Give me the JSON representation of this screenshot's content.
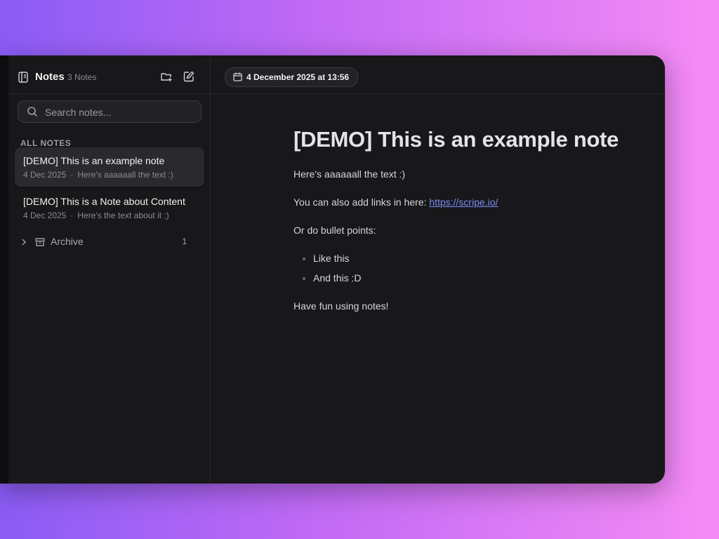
{
  "sidebar": {
    "title": "Notes",
    "count": "3 Notes",
    "search_placeholder": "Search notes...",
    "section_label": "ALL NOTES",
    "notes": [
      {
        "title": "[DEMO] This is an example note",
        "date": "4 Dec 2025",
        "preview": "Here's aaaaaall the text :)"
      },
      {
        "title": "[DEMO] This is a Note about Content",
        "date": "4 Dec 2025",
        "preview": "Here's the text about it ;)"
      }
    ],
    "archive": {
      "label": "Archive",
      "count": "1"
    }
  },
  "editor": {
    "date": "4 December 2025 at 13:56",
    "title": "[DEMO] This is an example note",
    "paragraph1": "Here's aaaaaall the text :)",
    "links_text": "You can also add links in here:",
    "link_url": "https://scripe.io/",
    "bullets_intro": "Or do bullet points:",
    "bullets": [
      "Like this",
      "And this :D"
    ],
    "closing": "Have fun using notes!"
  },
  "colors": {
    "background_gradient_start": "#8b5cf6",
    "background_gradient_end": "#f58bf5",
    "window_bg": "#18181b",
    "link": "#7a8cf5"
  }
}
